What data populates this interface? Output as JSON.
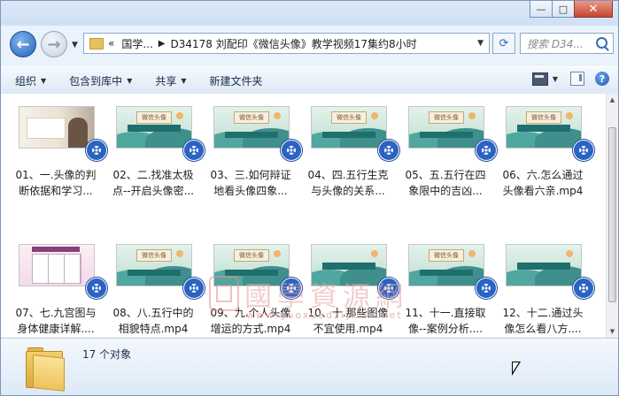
{
  "window": {
    "controls": {
      "minimize": "—",
      "maximize": "□",
      "close": "✕"
    }
  },
  "navigation": {
    "back_icon": "back-arrow-icon",
    "forward_icon": "forward-arrow-icon",
    "address": {
      "prefix": "«",
      "crumbs": [
        "国学...",
        "D34178 刘配印《微信头像》教学视频17集约8小时"
      ]
    },
    "search_placeholder": "搜索 D34..."
  },
  "toolbar": {
    "organize": "组织",
    "include_in_library": "包含到库中",
    "share": "共享",
    "new_folder": "新建文件夹"
  },
  "files": [
    {
      "line1": "01、一.头像的判",
      "line2": "断依据和学习...",
      "thumb": "a"
    },
    {
      "line1": "02、二.找准太极",
      "line2": "点--开启头像密...",
      "thumb": "b",
      "banner": "微信头像"
    },
    {
      "line1": "03、三.如何辩证",
      "line2": "地看头像四象...",
      "thumb": "b",
      "banner": "微信头像"
    },
    {
      "line1": "04、四.五行生克",
      "line2": "与头像的关系...",
      "thumb": "b",
      "banner": "微信头像"
    },
    {
      "line1": "05、五.五行在四",
      "line2": "象限中的吉凶...",
      "thumb": "b",
      "banner": "微信头像"
    },
    {
      "line1": "06、六.怎么通过",
      "line2": "头像看六亲.mp4",
      "thumb": "b",
      "banner": "微信头像"
    },
    {
      "line1": "07、七.九宫图与",
      "line2": "身体健康详解....",
      "thumb": "c"
    },
    {
      "line1": "08、八.五行中的",
      "line2": "相貌特点.mp4",
      "thumb": "b",
      "banner": "微信头像"
    },
    {
      "line1": "09、九.个人头像",
      "line2": "增运的方式.mp4",
      "thumb": "b",
      "banner": "微信头像"
    },
    {
      "line1": "10、十.那些图像",
      "line2": "不宜使用.mp4",
      "thumb": "d"
    },
    {
      "line1": "11、十一.直接取",
      "line2": "像--案例分析....",
      "thumb": "b",
      "banner": "微信头像"
    },
    {
      "line1": "12、十二.通过头",
      "line2": "像怎么看八方....",
      "thumb": "d"
    }
  ],
  "watermark": {
    "text": "國學資源網",
    "url": "www.guoxuedziyuan.net"
  },
  "details": {
    "count_text": "17 个对象"
  }
}
